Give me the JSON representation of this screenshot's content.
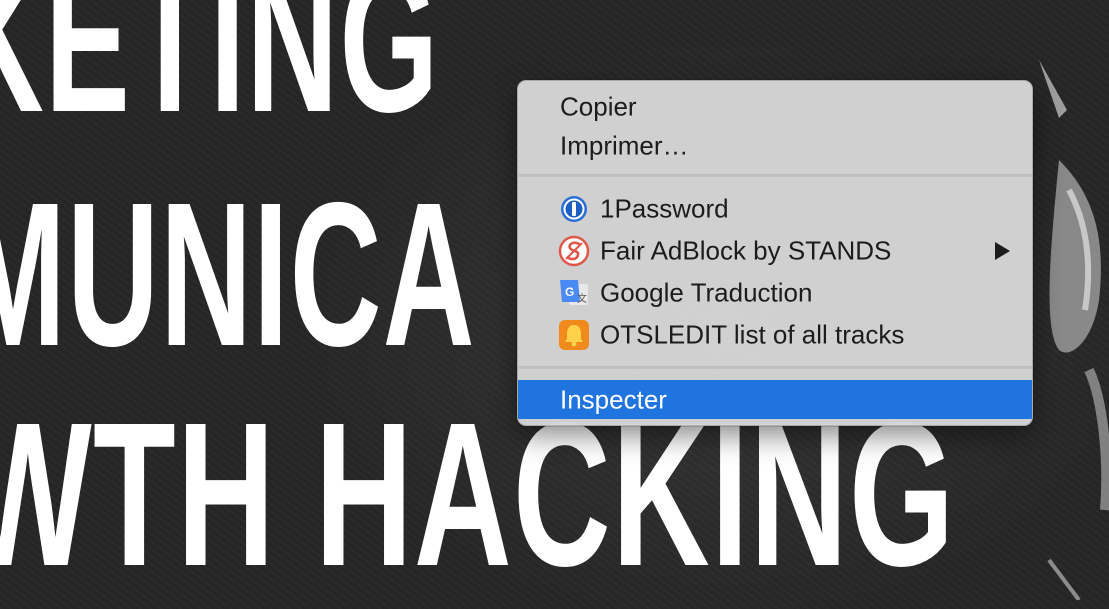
{
  "background": {
    "lines": [
      "KETING",
      "MUNICA",
      "WTH HACKING"
    ]
  },
  "menu": {
    "group1": [
      {
        "label": "Copier"
      },
      {
        "label": "Imprimer…"
      }
    ],
    "extensions": [
      {
        "label": "1Password",
        "icon": "1password-icon"
      },
      {
        "label": "Fair AdBlock by STANDS",
        "icon": "fair-adblock-icon",
        "submenu": true
      },
      {
        "label": "Google Traduction",
        "icon": "google-translate-icon"
      },
      {
        "label": "OTSLEDIT list of all tracks",
        "icon": "otsledit-bell-icon"
      }
    ],
    "group3": [
      {
        "label": "Inspecter",
        "selected": true
      }
    ],
    "colors": {
      "highlight": "#1f74e0",
      "menu_bg": "#d6d6d6",
      "text": "#1c1c1c"
    }
  }
}
